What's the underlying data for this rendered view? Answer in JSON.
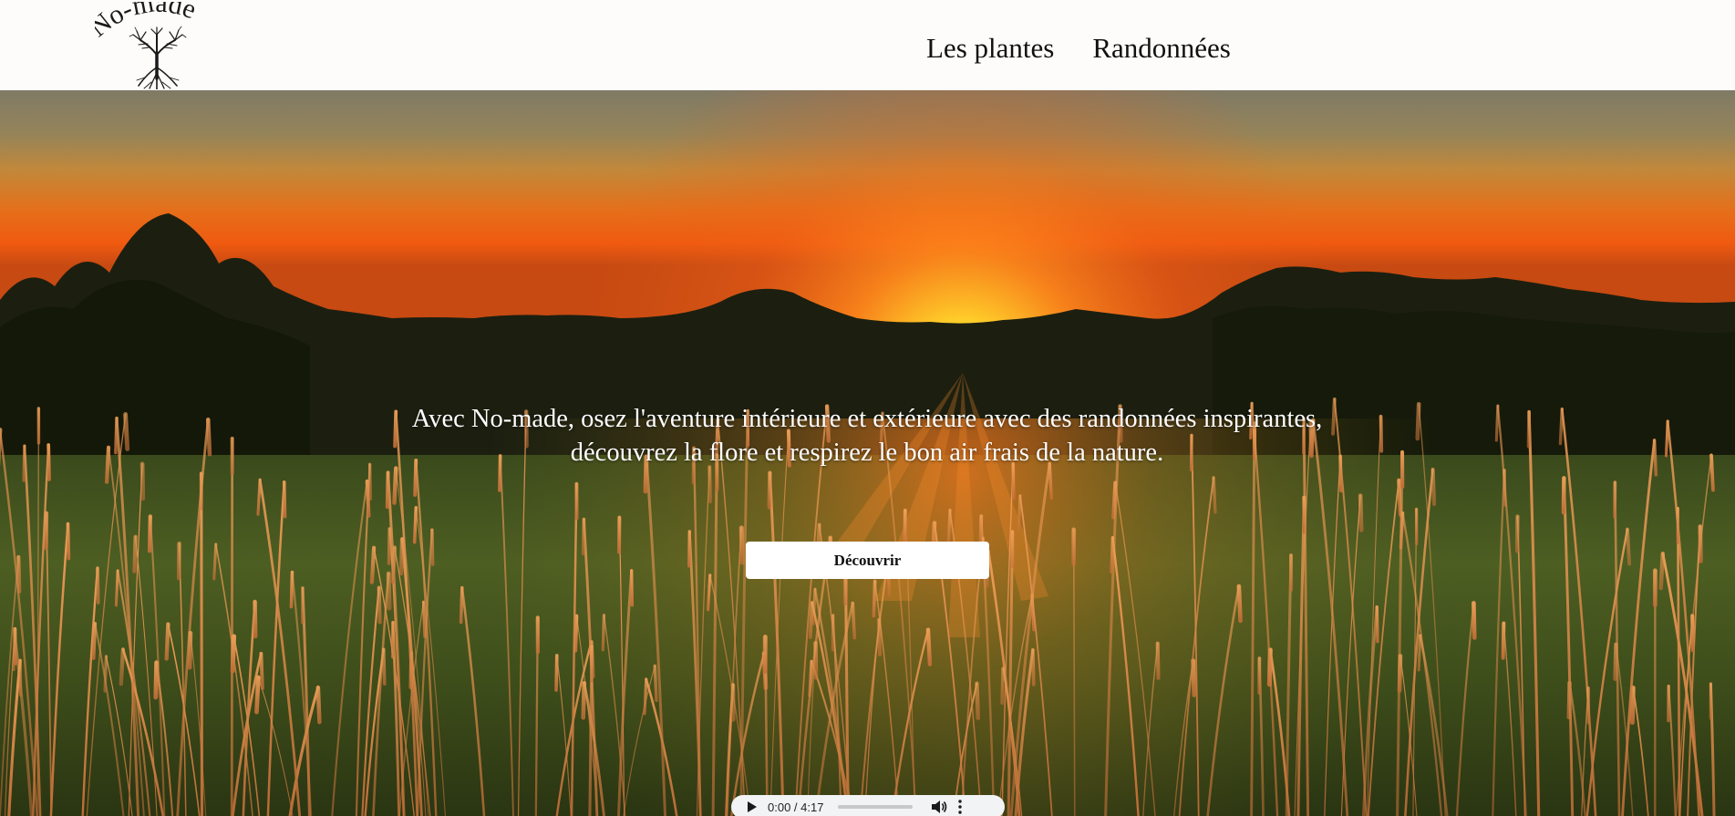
{
  "header": {
    "logo": {
      "text": "No-made",
      "icon": "tree-icon"
    },
    "nav": [
      {
        "label": "Les plantes"
      },
      {
        "label": "Randonnées"
      }
    ]
  },
  "hero": {
    "background": "sunset-field-photo",
    "tagline_line1": "Avec No-made, osez l'aventure intérieure et extérieure avec des randonnées inspirantes,",
    "tagline_line2": "découvrez la flore et respirez le bon air frais de la nature.",
    "cta_label": "Découvrir"
  },
  "audio": {
    "time": "0:00 / 4:17",
    "progress": 0,
    "icons": [
      "play-icon",
      "volume-icon",
      "more-options-icon"
    ]
  },
  "colors": {
    "header_bg": "#fdfcfa",
    "button_bg": "#ffffff",
    "hero_text": "#ffffff"
  }
}
